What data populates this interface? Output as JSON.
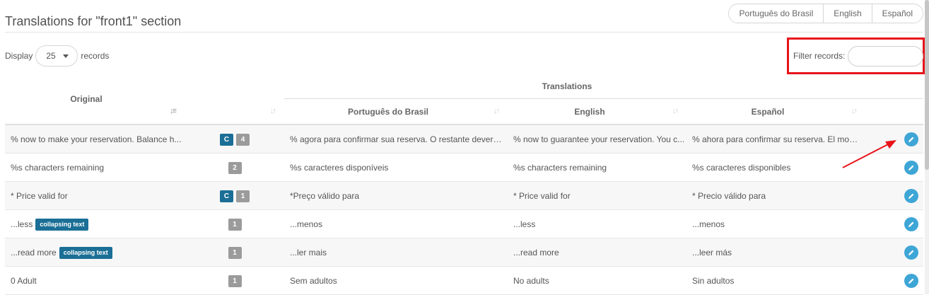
{
  "page": {
    "title": "Translations for \"front1\" section"
  },
  "language_switcher": [
    "Português do Brasil",
    "English",
    "Español"
  ],
  "display": {
    "prefix": "Display",
    "value": "25",
    "suffix": "records"
  },
  "filter": {
    "label": "Filter records:",
    "value": ""
  },
  "table": {
    "group_header": "Translations",
    "columns": {
      "original": "Original",
      "pt": "Português do Brasil",
      "en": "English",
      "es": "Español"
    },
    "rows": [
      {
        "original": "% now to make your reservation. Balance h...",
        "tag": "",
        "badges": [
          {
            "text": "C",
            "color": "blue"
          },
          {
            "text": "4",
            "color": "gray"
          }
        ],
        "pt": "% agora para confirmar sua reserva. O restante deverá ...",
        "en": "% now to guarantee your reservation. You c...",
        "es": "% ahora para confirmar su reserva. El mont..."
      },
      {
        "original": "%s characters remaining",
        "tag": "",
        "badges": [
          {
            "text": "2",
            "color": "gray"
          }
        ],
        "pt": "%s caracteres disponíveis",
        "en": "%s characters remaining",
        "es": "%s caracteres disponibles"
      },
      {
        "original": "* Price valid for",
        "tag": "",
        "badges": [
          {
            "text": "C",
            "color": "blue"
          },
          {
            "text": "1",
            "color": "gray"
          }
        ],
        "pt": "*Preço válido para",
        "en": "* Price valid for",
        "es": "* Precio válido para"
      },
      {
        "original": "...less",
        "tag": "collapsing text",
        "badges": [
          {
            "text": "1",
            "color": "gray"
          }
        ],
        "pt": "...menos",
        "en": "...less",
        "es": "...menos"
      },
      {
        "original": "...read more",
        "tag": "collapsing text",
        "badges": [
          {
            "text": "1",
            "color": "gray"
          }
        ],
        "pt": "...ler mais",
        "en": "...read more",
        "es": "...leer más"
      },
      {
        "original": "0 Adult",
        "tag": "",
        "badges": [
          {
            "text": "1",
            "color": "gray"
          }
        ],
        "pt": "Sem adultos",
        "en": "No adults",
        "es": "Sin adultos"
      }
    ]
  },
  "icons": {
    "edit": "pencil-icon",
    "sort": "sort-icon",
    "dropdown": "caret-down-icon"
  },
  "colors": {
    "accent_blue": "#1b6f96",
    "edit_button": "#3ea6d6",
    "badge_gray": "#9b9b9b",
    "highlight_red": "#e8141a"
  }
}
